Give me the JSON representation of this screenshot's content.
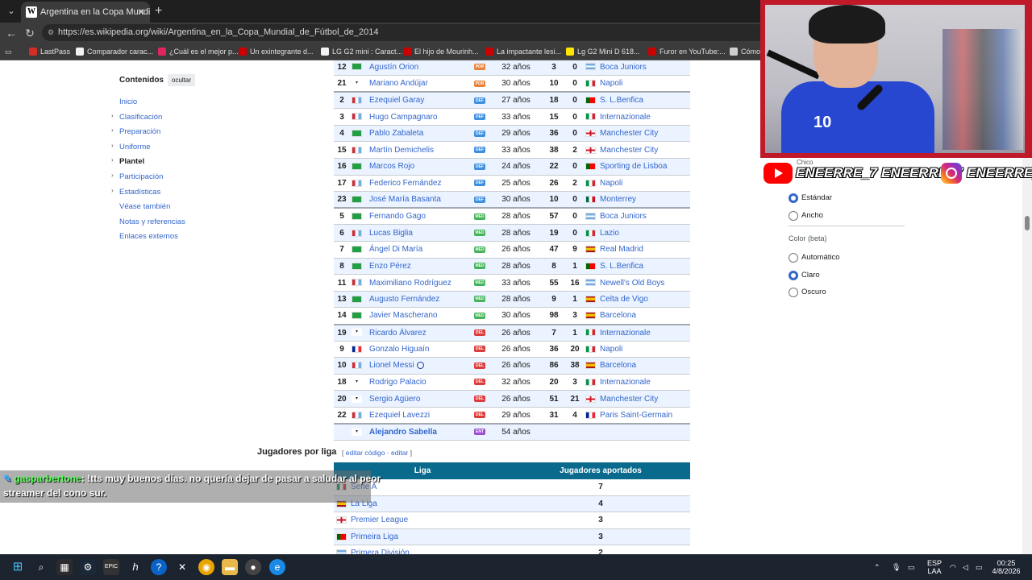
{
  "browser": {
    "tab_title": "Argentina en la Copa Mundial de",
    "tab_favicon": "W",
    "url": "https://es.wikipedia.org/wiki/Argentina_en_la_Copa_Mundial_de_Fútbol_de_2014",
    "bookmarks": [
      {
        "label": "LastPass",
        "color": "#d32d27"
      },
      {
        "label": "Comparador carac...",
        "color": "#f2f2f2"
      },
      {
        "label": "¿Cuál es el mejor p...",
        "color": "#e0245e"
      },
      {
        "label": "Un exintegrante d...",
        "color": "#cc0000"
      },
      {
        "label": "LG G2 mini : Caract...",
        "color": "#f2f2f2"
      },
      {
        "label": "El hijo de Mourinh...",
        "color": "#cc0000"
      },
      {
        "label": "La impactante lesi...",
        "color": "#cc0000"
      },
      {
        "label": "Lg G2 Mini D 618...",
        "color": "#ffe600"
      },
      {
        "label": "Furor en YouTube:...",
        "color": "#cc0000"
      },
      {
        "label": "Cómo",
        "color": "#cfcfcf"
      }
    ]
  },
  "toc": {
    "title": "Contenidos",
    "hide_label": "ocultar",
    "items": [
      {
        "label": "Inicio",
        "arrow": false,
        "active": false
      },
      {
        "label": "Clasificación",
        "arrow": true,
        "active": false
      },
      {
        "label": "Preparación",
        "arrow": true,
        "active": false
      },
      {
        "label": "Uniforme",
        "arrow": true,
        "active": false
      },
      {
        "label": "Plantel",
        "arrow": true,
        "active": true
      },
      {
        "label": "Participación",
        "arrow": true,
        "active": false
      },
      {
        "label": "Estadísticas",
        "arrow": true,
        "active": false
      },
      {
        "label": "Véase también",
        "arrow": false,
        "active": false
      },
      {
        "label": "Notas y referencias",
        "arrow": false,
        "active": false
      },
      {
        "label": "Enlaces externos",
        "arrow": false,
        "active": false
      }
    ]
  },
  "positions": {
    "POR": "#e8823a",
    "DEF": "#3e8fe0",
    "MED": "#45b35a",
    "DEL": "#dc3c3c",
    "ENT": "#9a4fd1"
  },
  "squad": [
    {
      "num": "12",
      "name": "Agustín Orion",
      "pos": "POR",
      "age": "32 años",
      "caps": "3",
      "goals": "0",
      "club": "Boca Juniors",
      "club_flag": "arg",
      "group_start": false,
      "alt": true
    },
    {
      "num": "21",
      "name": "Mariano Andújar",
      "pos": "POR",
      "age": "30 años",
      "caps": "10",
      "goals": "0",
      "club": "Napoli",
      "club_flag": "ita",
      "group_start": false,
      "alt": false
    },
    {
      "num": "2",
      "name": "Ezequiel Garay",
      "pos": "DEF",
      "age": "27 años",
      "caps": "18",
      "goals": "0",
      "club": "S. L.Benfica",
      "club_flag": "por",
      "group_start": true,
      "alt": true
    },
    {
      "num": "3",
      "name": "Hugo Campagnaro",
      "pos": "DEF",
      "age": "33 años",
      "caps": "15",
      "goals": "0",
      "club": "Internazionale",
      "club_flag": "ita",
      "group_start": false,
      "alt": false
    },
    {
      "num": "4",
      "name": "Pablo Zabaleta",
      "pos": "DEF",
      "age": "29 años",
      "caps": "36",
      "goals": "0",
      "club": "Manchester City",
      "club_flag": "eng",
      "group_start": false,
      "alt": true
    },
    {
      "num": "15",
      "name": "Martín Demichelis",
      "pos": "DEF",
      "age": "33 años",
      "caps": "38",
      "goals": "2",
      "club": "Manchester City",
      "club_flag": "eng",
      "group_start": false,
      "alt": false
    },
    {
      "num": "16",
      "name": "Marcos Rojo",
      "pos": "DEF",
      "age": "24 años",
      "caps": "22",
      "goals": "0",
      "club": "Sporting de Lisboa",
      "club_flag": "por",
      "group_start": false,
      "alt": true
    },
    {
      "num": "17",
      "name": "Federico Fernández",
      "pos": "DEF",
      "age": "25 años",
      "caps": "26",
      "goals": "2",
      "club": "Napoli",
      "club_flag": "ita",
      "group_start": false,
      "alt": false
    },
    {
      "num": "23",
      "name": "José María Basanta",
      "pos": "DEF",
      "age": "30 años",
      "caps": "10",
      "goals": "0",
      "club": "Monterrey",
      "club_flag": "mex",
      "group_start": false,
      "alt": true
    },
    {
      "num": "5",
      "name": "Fernando Gago",
      "pos": "MED",
      "age": "28 años",
      "caps": "57",
      "goals": "0",
      "club": "Boca Juniors",
      "club_flag": "arg",
      "group_start": true,
      "alt": false
    },
    {
      "num": "6",
      "name": "Lucas Biglia",
      "pos": "MED",
      "age": "28 años",
      "caps": "19",
      "goals": "0",
      "club": "Lazio",
      "club_flag": "ita",
      "group_start": false,
      "alt": true
    },
    {
      "num": "7",
      "name": "Ángel Di María",
      "pos": "MED",
      "age": "26 años",
      "caps": "47",
      "goals": "9",
      "club": "Real Madrid",
      "club_flag": "esp",
      "group_start": false,
      "alt": false
    },
    {
      "num": "8",
      "name": "Enzo Pérez",
      "pos": "MED",
      "age": "28 años",
      "caps": "8",
      "goals": "1",
      "club": "S. L.Benfica",
      "club_flag": "por",
      "group_start": false,
      "alt": true
    },
    {
      "num": "11",
      "name": "Maximiliano Rodríguez",
      "pos": "MED",
      "age": "33 años",
      "caps": "55",
      "goals": "16",
      "club": "Newell's Old Boys",
      "club_flag": "arg",
      "group_start": false,
      "alt": false
    },
    {
      "num": "13",
      "name": "Augusto Fernández",
      "pos": "MED",
      "age": "28 años",
      "caps": "9",
      "goals": "1",
      "club": "Celta de Vigo",
      "club_flag": "esp",
      "group_start": false,
      "alt": true
    },
    {
      "num": "14",
      "name": "Javier Mascherano",
      "pos": "MED",
      "age": "30 años",
      "caps": "98",
      "goals": "3",
      "club": "Barcelona",
      "club_flag": "esp",
      "group_start": false,
      "alt": false
    },
    {
      "num": "19",
      "name": "Ricardo Álvarez",
      "pos": "DEL",
      "age": "26 años",
      "caps": "7",
      "goals": "1",
      "club": "Internazionale",
      "club_flag": "ita",
      "group_start": true,
      "alt": true
    },
    {
      "num": "9",
      "name": "Gonzalo Higuaín",
      "pos": "DEL",
      "age": "26 años",
      "caps": "36",
      "goals": "20",
      "club": "Napoli",
      "club_flag": "ita",
      "group_start": false,
      "alt": false
    },
    {
      "num": "10",
      "name": "Lionel Messi",
      "pos": "DEL",
      "age": "26 años",
      "caps": "86",
      "goals": "38",
      "club": "Barcelona",
      "club_flag": "esp",
      "group_start": false,
      "alt": true,
      "captain": true
    },
    {
      "num": "18",
      "name": "Rodrigo Palacio",
      "pos": "DEL",
      "age": "32 años",
      "caps": "20",
      "goals": "3",
      "club": "Internazionale",
      "club_flag": "ita",
      "group_start": false,
      "alt": false
    },
    {
      "num": "20",
      "name": "Sergio Agüero",
      "pos": "DEL",
      "age": "26 años",
      "caps": "51",
      "goals": "21",
      "club": "Manchester City",
      "club_flag": "eng",
      "group_start": false,
      "alt": true
    },
    {
      "num": "22",
      "name": "Ezequiel Lavezzi",
      "pos": "DEL",
      "age": "29 años",
      "caps": "31",
      "goals": "4",
      "club": "Paris Saint-Germain",
      "club_flag": "fra",
      "group_start": false,
      "alt": false
    },
    {
      "num": "",
      "name": "Alejandro Sabella",
      "pos": "ENT",
      "age": "54 años",
      "caps": "",
      "goals": "",
      "club": "",
      "club_flag": "",
      "group_start": true,
      "alt": true,
      "coach": true
    }
  ],
  "league_section": {
    "title": "Jugadores por liga",
    "edit_open": "[",
    "edit_code": "editar código",
    "edit_sep": " · ",
    "edit": "editar",
    "edit_close": "]",
    "col_league": "Liga",
    "col_players": "Jugadores aportados",
    "rows": [
      {
        "league": "Serie A",
        "flag": "ita",
        "count": "7",
        "alt": false
      },
      {
        "league": "La Liga",
        "flag": "esp",
        "count": "4",
        "alt": true
      },
      {
        "league": "Premier League",
        "flag": "eng",
        "count": "3",
        "alt": false
      },
      {
        "league": "Primeira Liga",
        "flag": "por",
        "count": "3",
        "alt": true
      },
      {
        "league": "Primera División",
        "flag": "arg",
        "count": "2",
        "alt": false
      }
    ]
  },
  "chat": {
    "user": "gasparbertone",
    "message_line1": ": !tts muy buenos días. no quería dejar de pasar a saludar al peor",
    "message_line2": "streamer del cono sur."
  },
  "appearance": {
    "partial_top": "Chico",
    "width_options": [
      {
        "label": "Estándar",
        "selected": true
      },
      {
        "label": "Ancho",
        "selected": false
      }
    ],
    "color_heading": "Color (beta)",
    "color_options": [
      {
        "label": "Automático",
        "selected": false
      },
      {
        "label": "Claro",
        "selected": true
      },
      {
        "label": "Oscuro",
        "selected": false
      }
    ]
  },
  "overlay": {
    "handle": "ENEERRE_7"
  },
  "taskbar": {
    "lang_line1": "ESP",
    "lang_line2": "LAA",
    "time": "00:25",
    "date": "4/8/2026"
  }
}
